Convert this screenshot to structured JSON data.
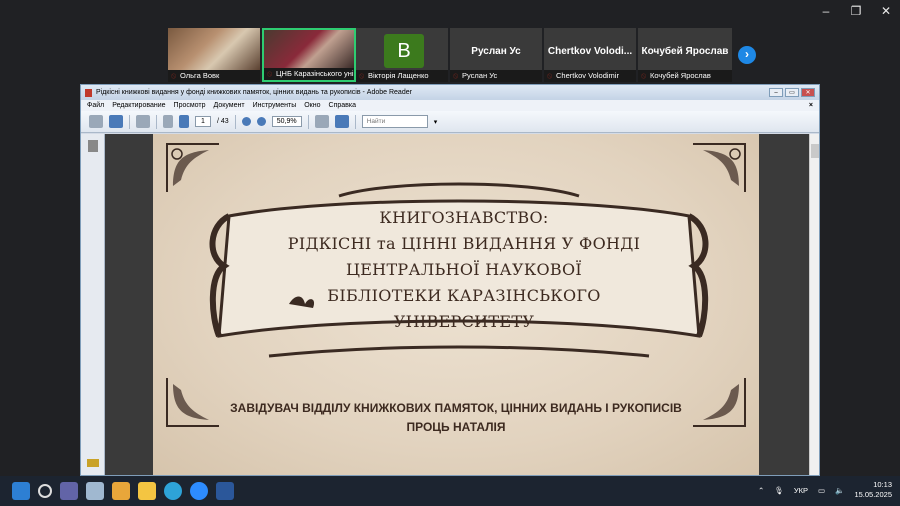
{
  "window_controls": {
    "minimize": "–",
    "restore": "❐",
    "close": "✕"
  },
  "participants": [
    {
      "name": "Ольга Вовк",
      "type": "photo1"
    },
    {
      "name": "ЦНБ Каразінського універ...",
      "type": "photo2",
      "active": true
    },
    {
      "name": "Вікторія Лащенко",
      "type": "avatar",
      "avatar_letter": "В"
    },
    {
      "name": "Руслан Ус",
      "type": "text",
      "display": "Руслан Ус"
    },
    {
      "name": "Chertkov Volodimir",
      "type": "text",
      "display": "Chertkov Volodi..."
    },
    {
      "name": "Кочубей Ярослав",
      "type": "text",
      "display": "Кочубей Ярослав"
    }
  ],
  "adobe": {
    "title": "Рідкісні книжкові видання у фонді книжкових памяток, цінних видань та рукописів - Adobe Reader",
    "menu": [
      "Файл",
      "Редактирование",
      "Просмотр",
      "Документ",
      "Инструменты",
      "Окно",
      "Справка"
    ],
    "close_mark": "×",
    "page_current": "1",
    "page_total": "/ 43",
    "zoom": "50,9%",
    "find_placeholder": "Найти"
  },
  "slide": {
    "title_lines": [
      "КНИГОЗНАВСТВО:",
      "РІДКІСНІ та ЦІННІ ВИДАННЯ У ФОНДІ",
      "ЦЕНТРАЛЬНОЇ НАУКОВОЇ",
      "БІБЛІОТЕКИ КАРАЗІНСЬКОГО",
      "УНІВЕРСИТЕТУ"
    ],
    "subtitle_lines": [
      "ЗАВІДУВАЧ ВІДДІЛУ КНИЖКОВИХ ПАМЯТОК, ЦІННИХ ВИДАНЬ І РУКОПИСІВ",
      "ПРОЦЬ НАТАЛІЯ"
    ]
  },
  "tray": {
    "language": "УКР",
    "time": "10:13",
    "date": "15.05.2025"
  }
}
